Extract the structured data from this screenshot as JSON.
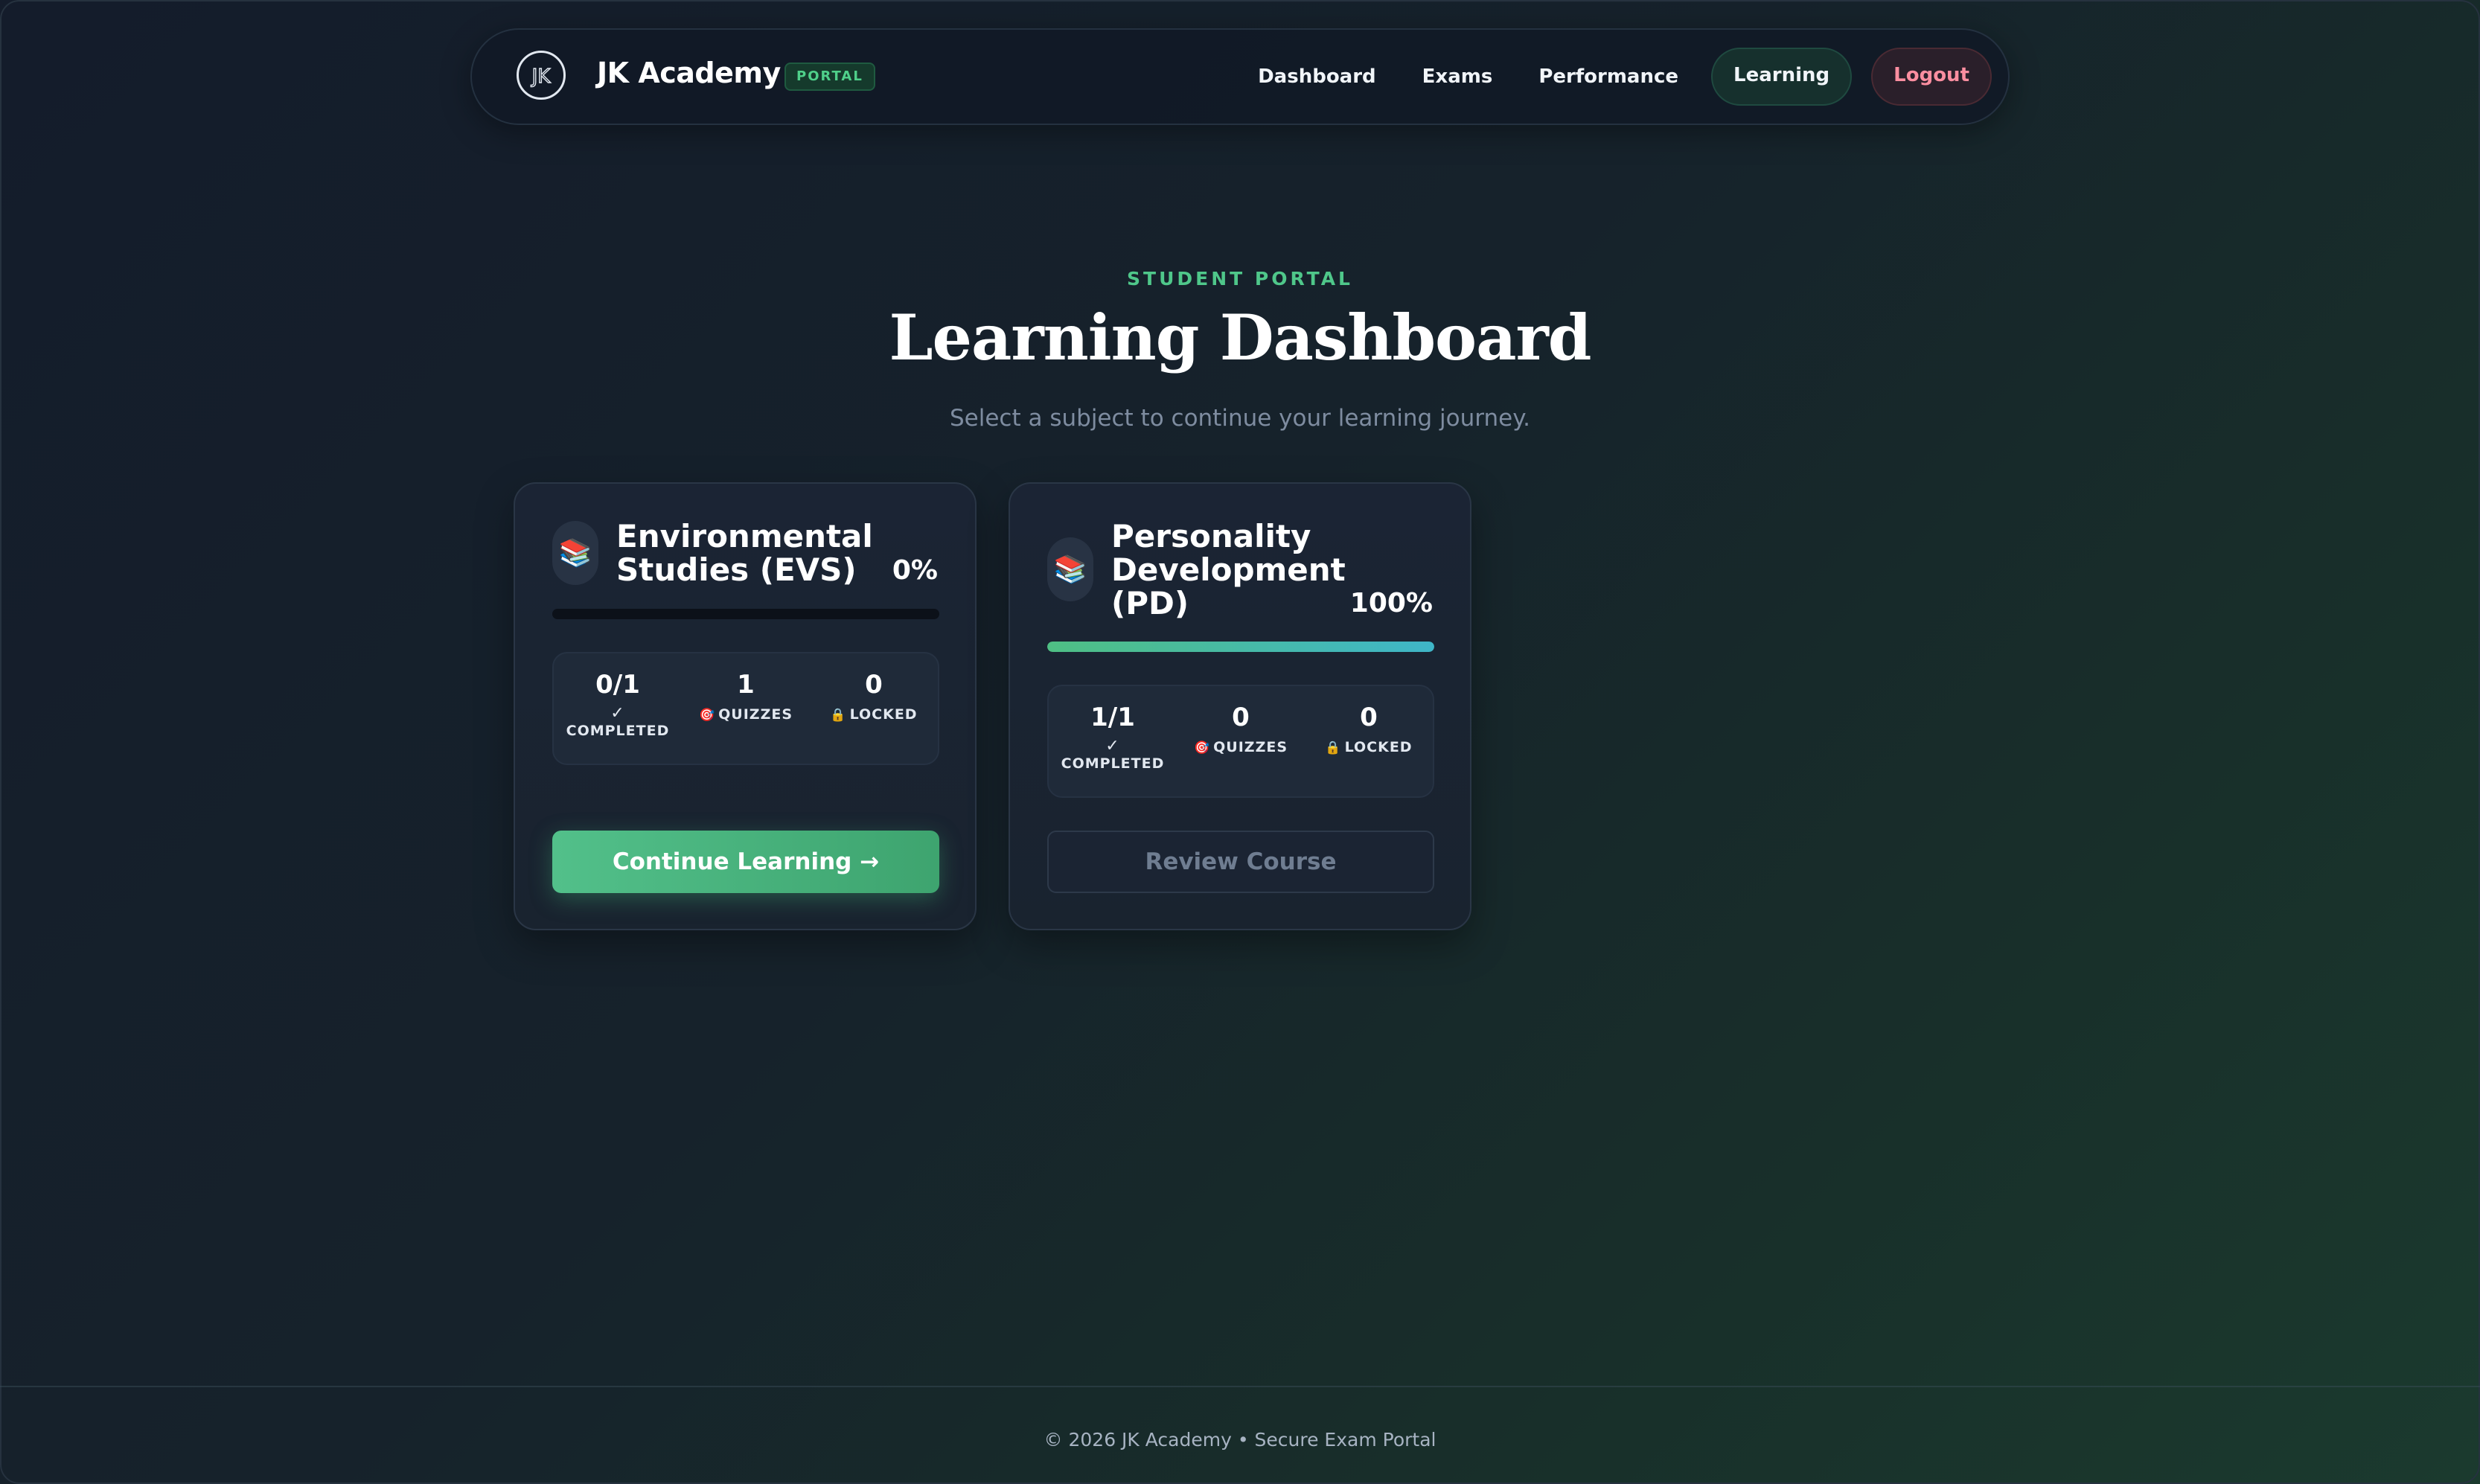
{
  "nav": {
    "logo_text": "JK",
    "brand": "JK Academy",
    "badge": "PORTAL",
    "links": [
      {
        "label": "Dashboard"
      },
      {
        "label": "Exams"
      },
      {
        "label": "Performance"
      },
      {
        "label": "Learning"
      },
      {
        "label": "Logout"
      }
    ],
    "active_link": "Learning"
  },
  "hero": {
    "eyebrow": "STUDENT PORTAL",
    "title": "Learning Dashboard",
    "subtitle": "Select a subject to continue your learning journey."
  },
  "subjects": [
    {
      "icon": "books-icon",
      "title": "Environmental Studies (EVS)",
      "percent_label": "0%",
      "progress": 0,
      "completed_value": "0/1",
      "completed_check": "✓",
      "completed_label": "COMPLETED",
      "quizzes_value": "1",
      "quizzes_label": "QUIZZES",
      "locked_value": "0",
      "locked_label": "LOCKED",
      "button_label": "Continue Learning →",
      "button_style": "primary"
    },
    {
      "icon": "books-icon",
      "title": "Personality Development (PD)",
      "percent_label": "100%",
      "progress": 1,
      "completed_value": "1/1",
      "completed_check": "✓",
      "completed_label": "COMPLETED",
      "quizzes_value": "0",
      "quizzes_label": "QUIZZES",
      "locked_value": "0",
      "locked_label": "LOCKED",
      "button_label": "Review Course",
      "button_style": "secondary"
    }
  ],
  "footer": {
    "text": "© 2026 JK Academy • Secure Exam Portal"
  },
  "colors": {
    "accent": "#4fc78a",
    "logout": "#fb8ea0",
    "progress_start": "#4fbf84",
    "progress_end": "#3fb6c8"
  }
}
